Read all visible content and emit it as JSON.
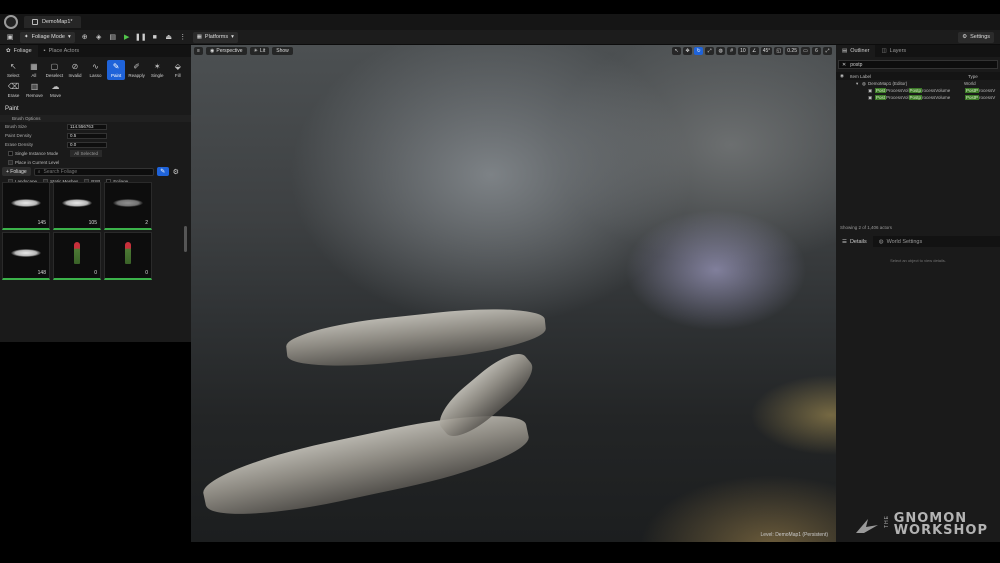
{
  "document_tab": {
    "title": "DemoMap1*"
  },
  "toolbar": {
    "mode": "Foliage Mode",
    "platforms": "Platforms",
    "settings": "Settings"
  },
  "left_panel": {
    "tabs": [
      {
        "label": "Foliage"
      },
      {
        "label": "Place Actors"
      }
    ],
    "tools_row1": [
      {
        "label": "Select",
        "icon": "cursor-icon"
      },
      {
        "label": "All",
        "icon": "select-all-icon"
      },
      {
        "label": "Deselect",
        "icon": "deselect-icon"
      },
      {
        "label": "Invalid",
        "icon": "invalid-icon"
      },
      {
        "label": "Lasso",
        "icon": "lasso-icon"
      },
      {
        "label": "Paint",
        "icon": "paint-brush-icon"
      },
      {
        "label": "Reapply",
        "icon": "reapply-icon"
      },
      {
        "label": "Single",
        "icon": "single-icon"
      },
      {
        "label": "Fill",
        "icon": "fill-icon"
      }
    ],
    "tools_row2": [
      {
        "label": "Erase",
        "icon": "erase-icon"
      },
      {
        "label": "Remove",
        "icon": "remove-icon"
      },
      {
        "label": "Move",
        "icon": "move-icon"
      }
    ],
    "section": "Paint",
    "brush_options_header": "Brush Options",
    "brush_size": {
      "label": "Brush Size",
      "value": "114.556763"
    },
    "paint_density": {
      "label": "Paint Density",
      "value": "0.5"
    },
    "erase_density": {
      "label": "Erase Density",
      "value": "0.0"
    },
    "single_instance": {
      "label": "Single Instance Mode",
      "dropdown": "All Selected"
    },
    "place_current": {
      "label": "Place in Current Level"
    },
    "filters_header": "Filters",
    "filters": [
      {
        "label": "Landscape"
      },
      {
        "label": "Static Meshes"
      },
      {
        "label": "BSP"
      },
      {
        "label": "Foliage"
      }
    ],
    "translucent": {
      "label": "Translucent"
    },
    "add_foliage": "+ Foliage",
    "search_placeholder": "Search Foliage",
    "thumbnails": [
      {
        "count": "145",
        "kind": "grass"
      },
      {
        "count": "105",
        "kind": "grass"
      },
      {
        "count": "2",
        "kind": "grass"
      },
      {
        "count": "148",
        "kind": "grass"
      },
      {
        "count": "0",
        "kind": "flower"
      },
      {
        "count": "0",
        "kind": "flower"
      }
    ]
  },
  "viewport": {
    "perspective": "Perspective",
    "lit": "Lit",
    "show": "Show",
    "angle": "45°",
    "speed": "0.25",
    "cam": "6",
    "grid": "10",
    "level": "Level: DemoMap1 (Persistent)"
  },
  "right_panel": {
    "tabs": [
      {
        "label": "Outliner"
      },
      {
        "label": "Layers"
      }
    ],
    "search_value": "postp",
    "col_item": "Item Label",
    "col_type": "Type",
    "rows": [
      {
        "name": "DemoMap1 (Editor)",
        "type": "World"
      },
      {
        "pre": "Post",
        "mid": "ProcessVol",
        "hl": "Postp",
        "post": "rocessVolume",
        "type_hl": "PostP",
        "type": "rocessV"
      },
      {
        "pre": "Post",
        "mid": "ProcessVol",
        "hl": "Postp",
        "post": "rocessVolume",
        "type_hl": "PostP",
        "type": "rocessV"
      }
    ],
    "status": "Showing 2 of 1,406 actors",
    "details_tabs": [
      {
        "label": "Details"
      },
      {
        "label": "World Settings"
      }
    ],
    "details_empty": "Select an object to view details."
  },
  "watermark": {
    "the": "THE",
    "line1": "GNOMON",
    "line2": "WORKSHOP"
  }
}
